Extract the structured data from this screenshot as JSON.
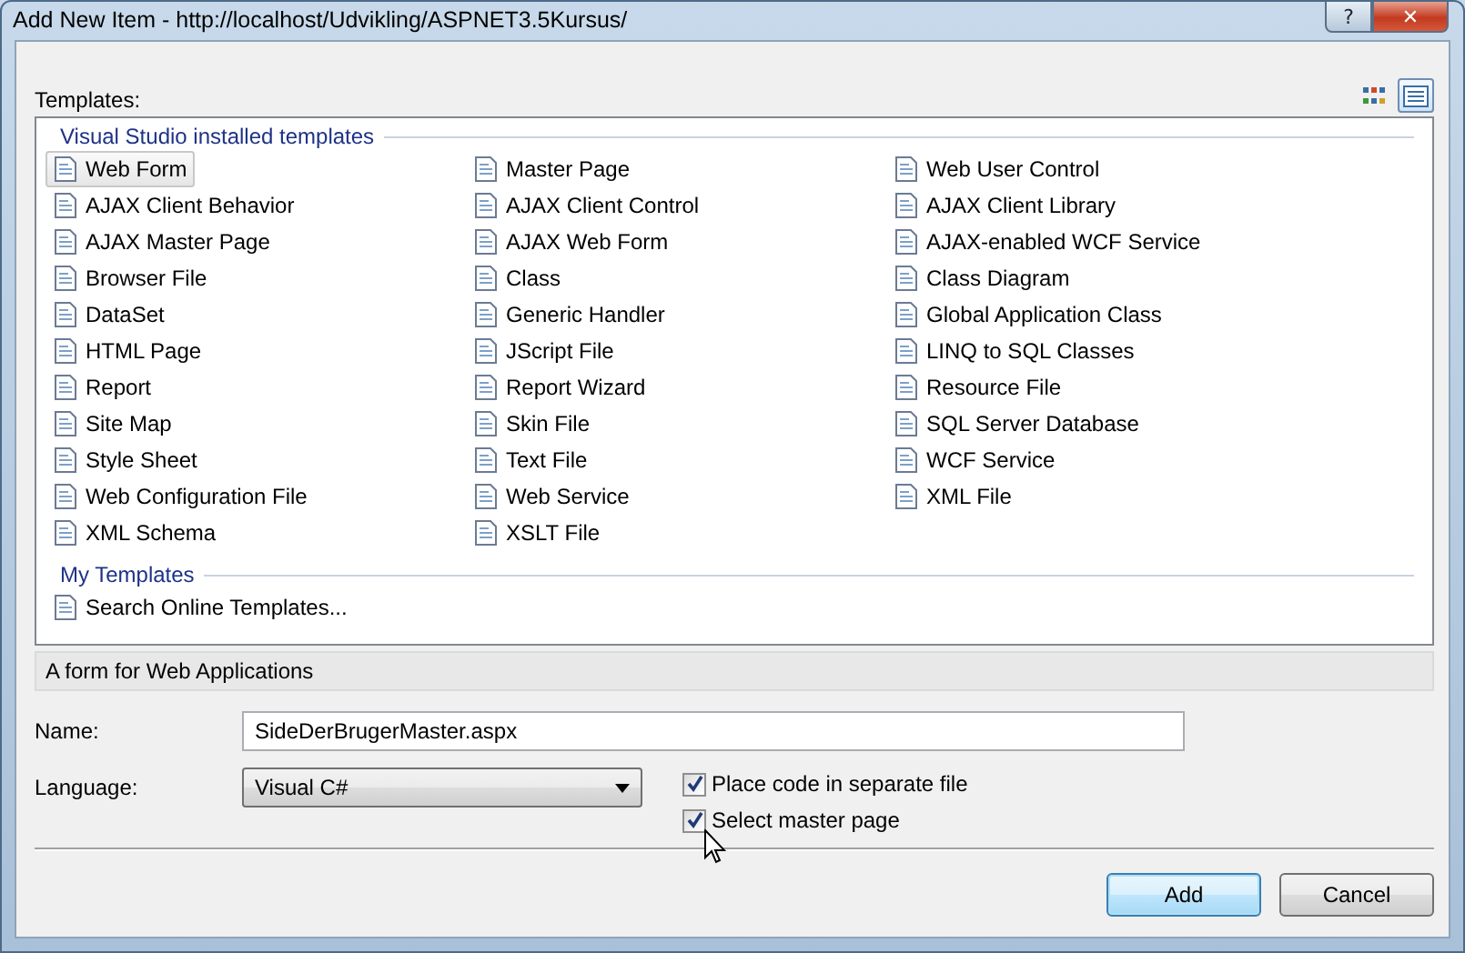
{
  "window": {
    "title": "Add New Item - http://localhost/Udvikling/ASPNET3.5Kursus/",
    "buttons": [
      {
        "kind": "help",
        "label": "?"
      },
      {
        "kind": "close",
        "label": "✕"
      }
    ]
  },
  "templates_label": "Templates:",
  "view_buttons": [
    {
      "kind": "large-icons",
      "selected": false
    },
    {
      "kind": "small-icons",
      "selected": true
    }
  ],
  "groups": [
    {
      "heading": "Visual Studio installed templates",
      "items": [
        {
          "label": "Web Form",
          "selected": true
        },
        {
          "label": "Master Page",
          "selected": false
        },
        {
          "label": "Web User Control",
          "selected": false
        },
        {
          "label": "AJAX Client Behavior",
          "selected": false
        },
        {
          "label": "AJAX Client Control",
          "selected": false
        },
        {
          "label": "AJAX Client Library",
          "selected": false
        },
        {
          "label": "AJAX Master Page",
          "selected": false
        },
        {
          "label": "AJAX Web Form",
          "selected": false
        },
        {
          "label": "AJAX-enabled WCF Service",
          "selected": false
        },
        {
          "label": "Browser File",
          "selected": false
        },
        {
          "label": "Class",
          "selected": false
        },
        {
          "label": "Class Diagram",
          "selected": false
        },
        {
          "label": "DataSet",
          "selected": false
        },
        {
          "label": "Generic Handler",
          "selected": false
        },
        {
          "label": "Global Application Class",
          "selected": false
        },
        {
          "label": "HTML Page",
          "selected": false
        },
        {
          "label": "JScript File",
          "selected": false
        },
        {
          "label": "LINQ to SQL Classes",
          "selected": false
        },
        {
          "label": "Report",
          "selected": false
        },
        {
          "label": "Report Wizard",
          "selected": false
        },
        {
          "label": "Resource File",
          "selected": false
        },
        {
          "label": "Site Map",
          "selected": false
        },
        {
          "label": "Skin File",
          "selected": false
        },
        {
          "label": "SQL Server Database",
          "selected": false
        },
        {
          "label": "Style Sheet",
          "selected": false
        },
        {
          "label": "Text File",
          "selected": false
        },
        {
          "label": "WCF Service",
          "selected": false
        },
        {
          "label": "Web Configuration File",
          "selected": false
        },
        {
          "label": "Web Service",
          "selected": false
        },
        {
          "label": "XML File",
          "selected": false
        },
        {
          "label": "XML Schema",
          "selected": false
        },
        {
          "label": "XSLT File",
          "selected": false
        }
      ]
    },
    {
      "heading": "My Templates",
      "items": [
        {
          "label": "Search Online Templates...",
          "selected": false
        }
      ]
    }
  ],
  "description": "A form for Web Applications",
  "name_field": {
    "label": "Name:",
    "value": "SideDerBrugerMaster.aspx"
  },
  "language_field": {
    "label": "Language:",
    "value": "Visual C#"
  },
  "options": [
    {
      "label": "Place code in separate file",
      "checked": true
    },
    {
      "label": "Select master page",
      "checked": true
    }
  ],
  "buttons": [
    {
      "label": "Add",
      "default": true
    },
    {
      "label": "Cancel",
      "default": false
    }
  ]
}
